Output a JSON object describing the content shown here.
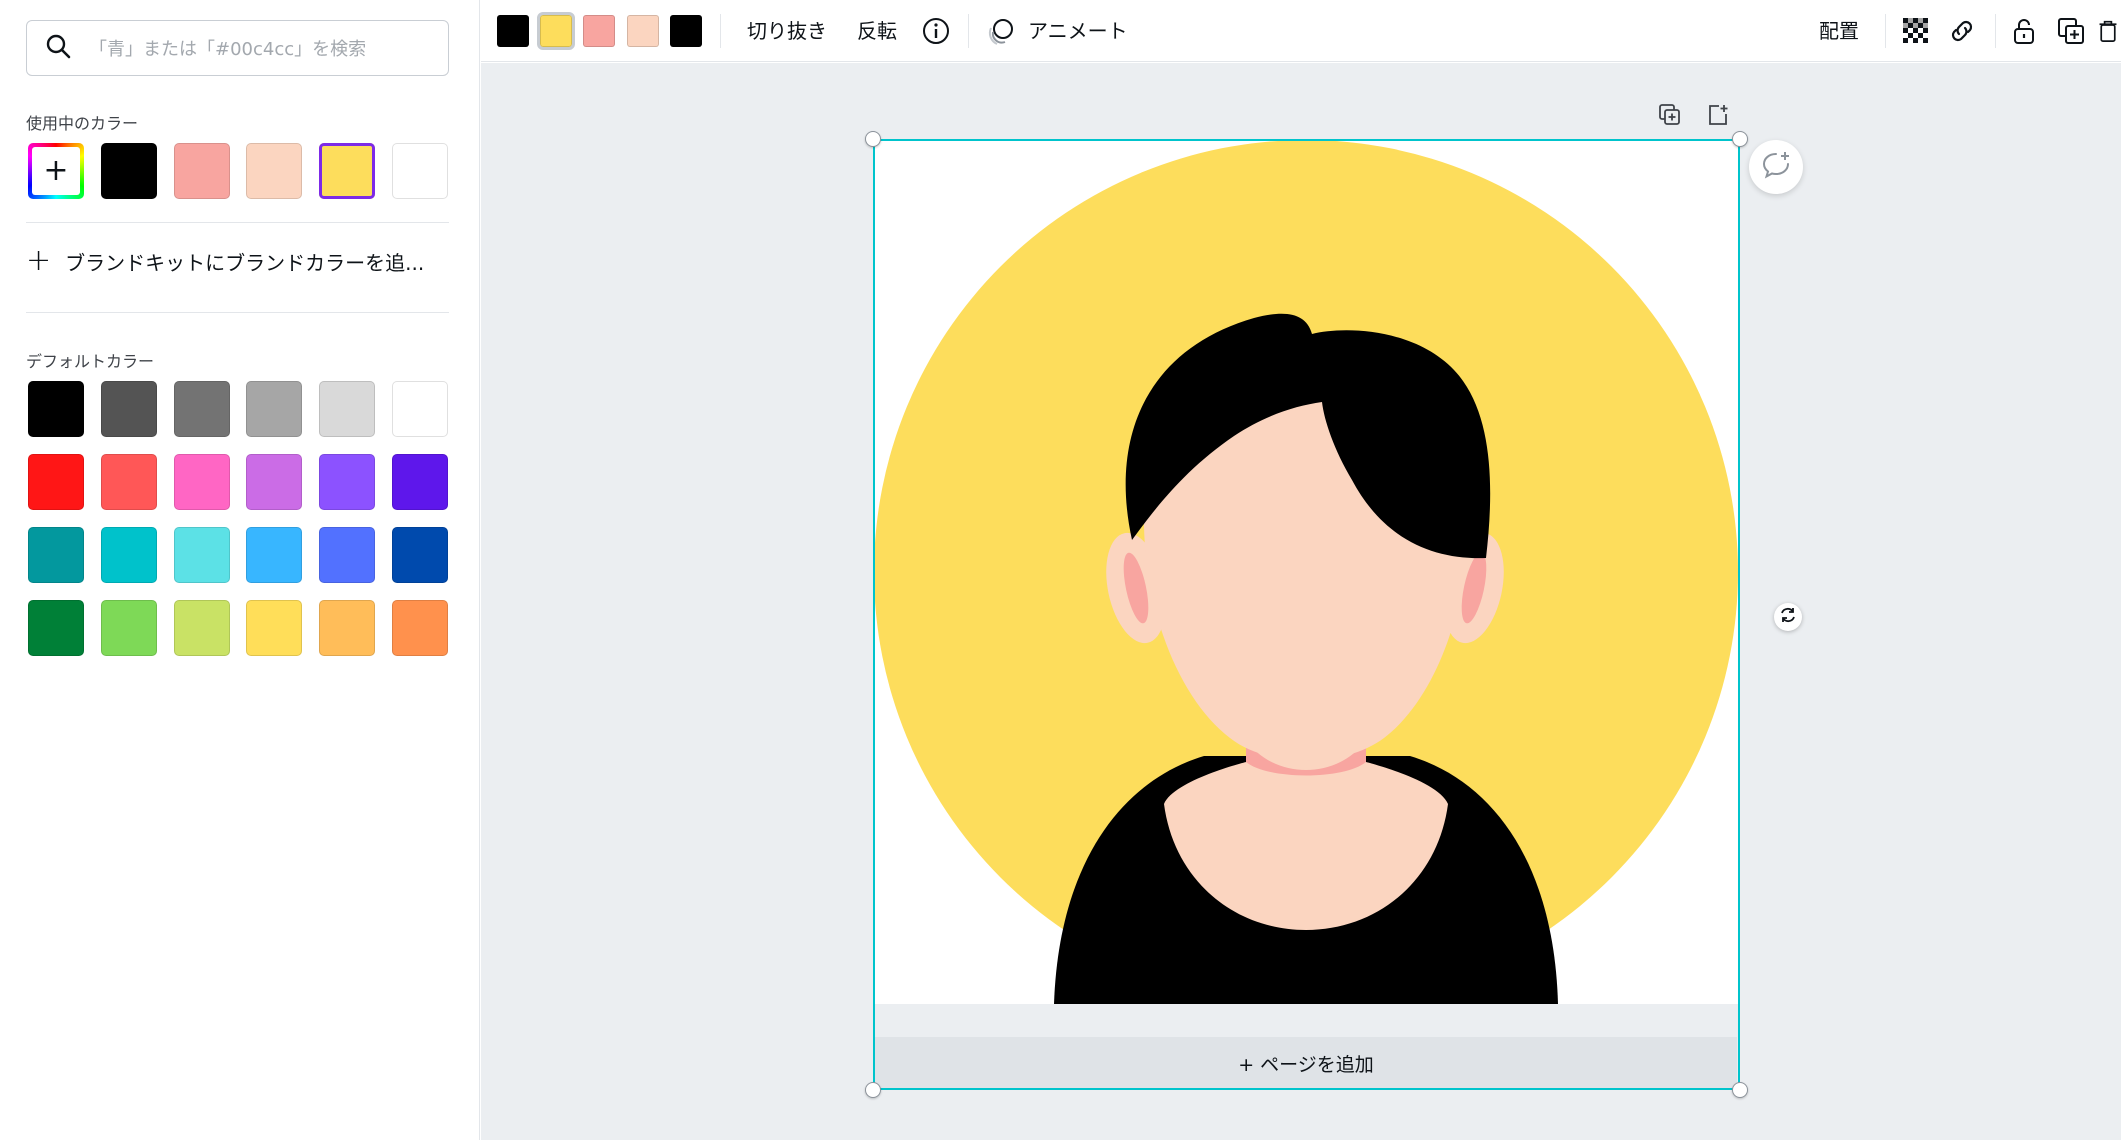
{
  "search": {
    "placeholder": "「青」または「#00c4cc」を検索",
    "icon": "search-icon"
  },
  "in_use": {
    "title": "使用中のカラー",
    "add_icon": "plus-icon",
    "colors": [
      "#000000",
      "#f8a5a0",
      "#fbd5c0",
      "#fddd5c",
      "#ffffff"
    ],
    "selected": "#fddd5c"
  },
  "brand": {
    "label": "ブランドキットにブランドカラーを追..."
  },
  "defaults": {
    "title": "デフォルトカラー",
    "rows": [
      [
        "#000000",
        "#545454",
        "#737373",
        "#a6a6a6",
        "#d9d9d9",
        "#ffffff"
      ],
      [
        "#ff1616",
        "#ff5757",
        "#ff66c4",
        "#cb6ce6",
        "#8c52ff",
        "#5e17eb"
      ],
      [
        "#03989e",
        "#00c2cb",
        "#5ce1e6",
        "#38b6ff",
        "#5271ff",
        "#004aad"
      ],
      [
        "#008037",
        "#7ed957",
        "#c9e265",
        "#ffde59",
        "#ffbd59",
        "#ff914d"
      ]
    ]
  },
  "toolbar": {
    "swatches": [
      "#000000",
      "#fddd5c",
      "#f8a5a0",
      "#fbd5c0",
      "#000000"
    ],
    "selected_swatch": 1,
    "crop": "切り抜き",
    "flip": "反転",
    "info_icon": "info-icon",
    "animate_icon": "animate-icon",
    "animate": "アニメート",
    "position": "配置",
    "transparency_icon": "transparency-icon",
    "link_icon": "link-icon",
    "lock_icon": "lock-icon",
    "duplicate_icon": "duplicate-icon",
    "delete_icon": "trash-icon"
  },
  "canvas": {
    "page_controls": [
      "duplicate-page-icon",
      "add-page-icon"
    ],
    "comment_icon": "add-comment-icon",
    "rotate_icon": "rotate-icon",
    "add_page": "+ ページを追加",
    "art_colors": {
      "circle": "#fddd5c",
      "skin": "#fbd5c0",
      "ear": "#f8a5a0",
      "hair": "#000000",
      "shirt": "#000000"
    }
  }
}
